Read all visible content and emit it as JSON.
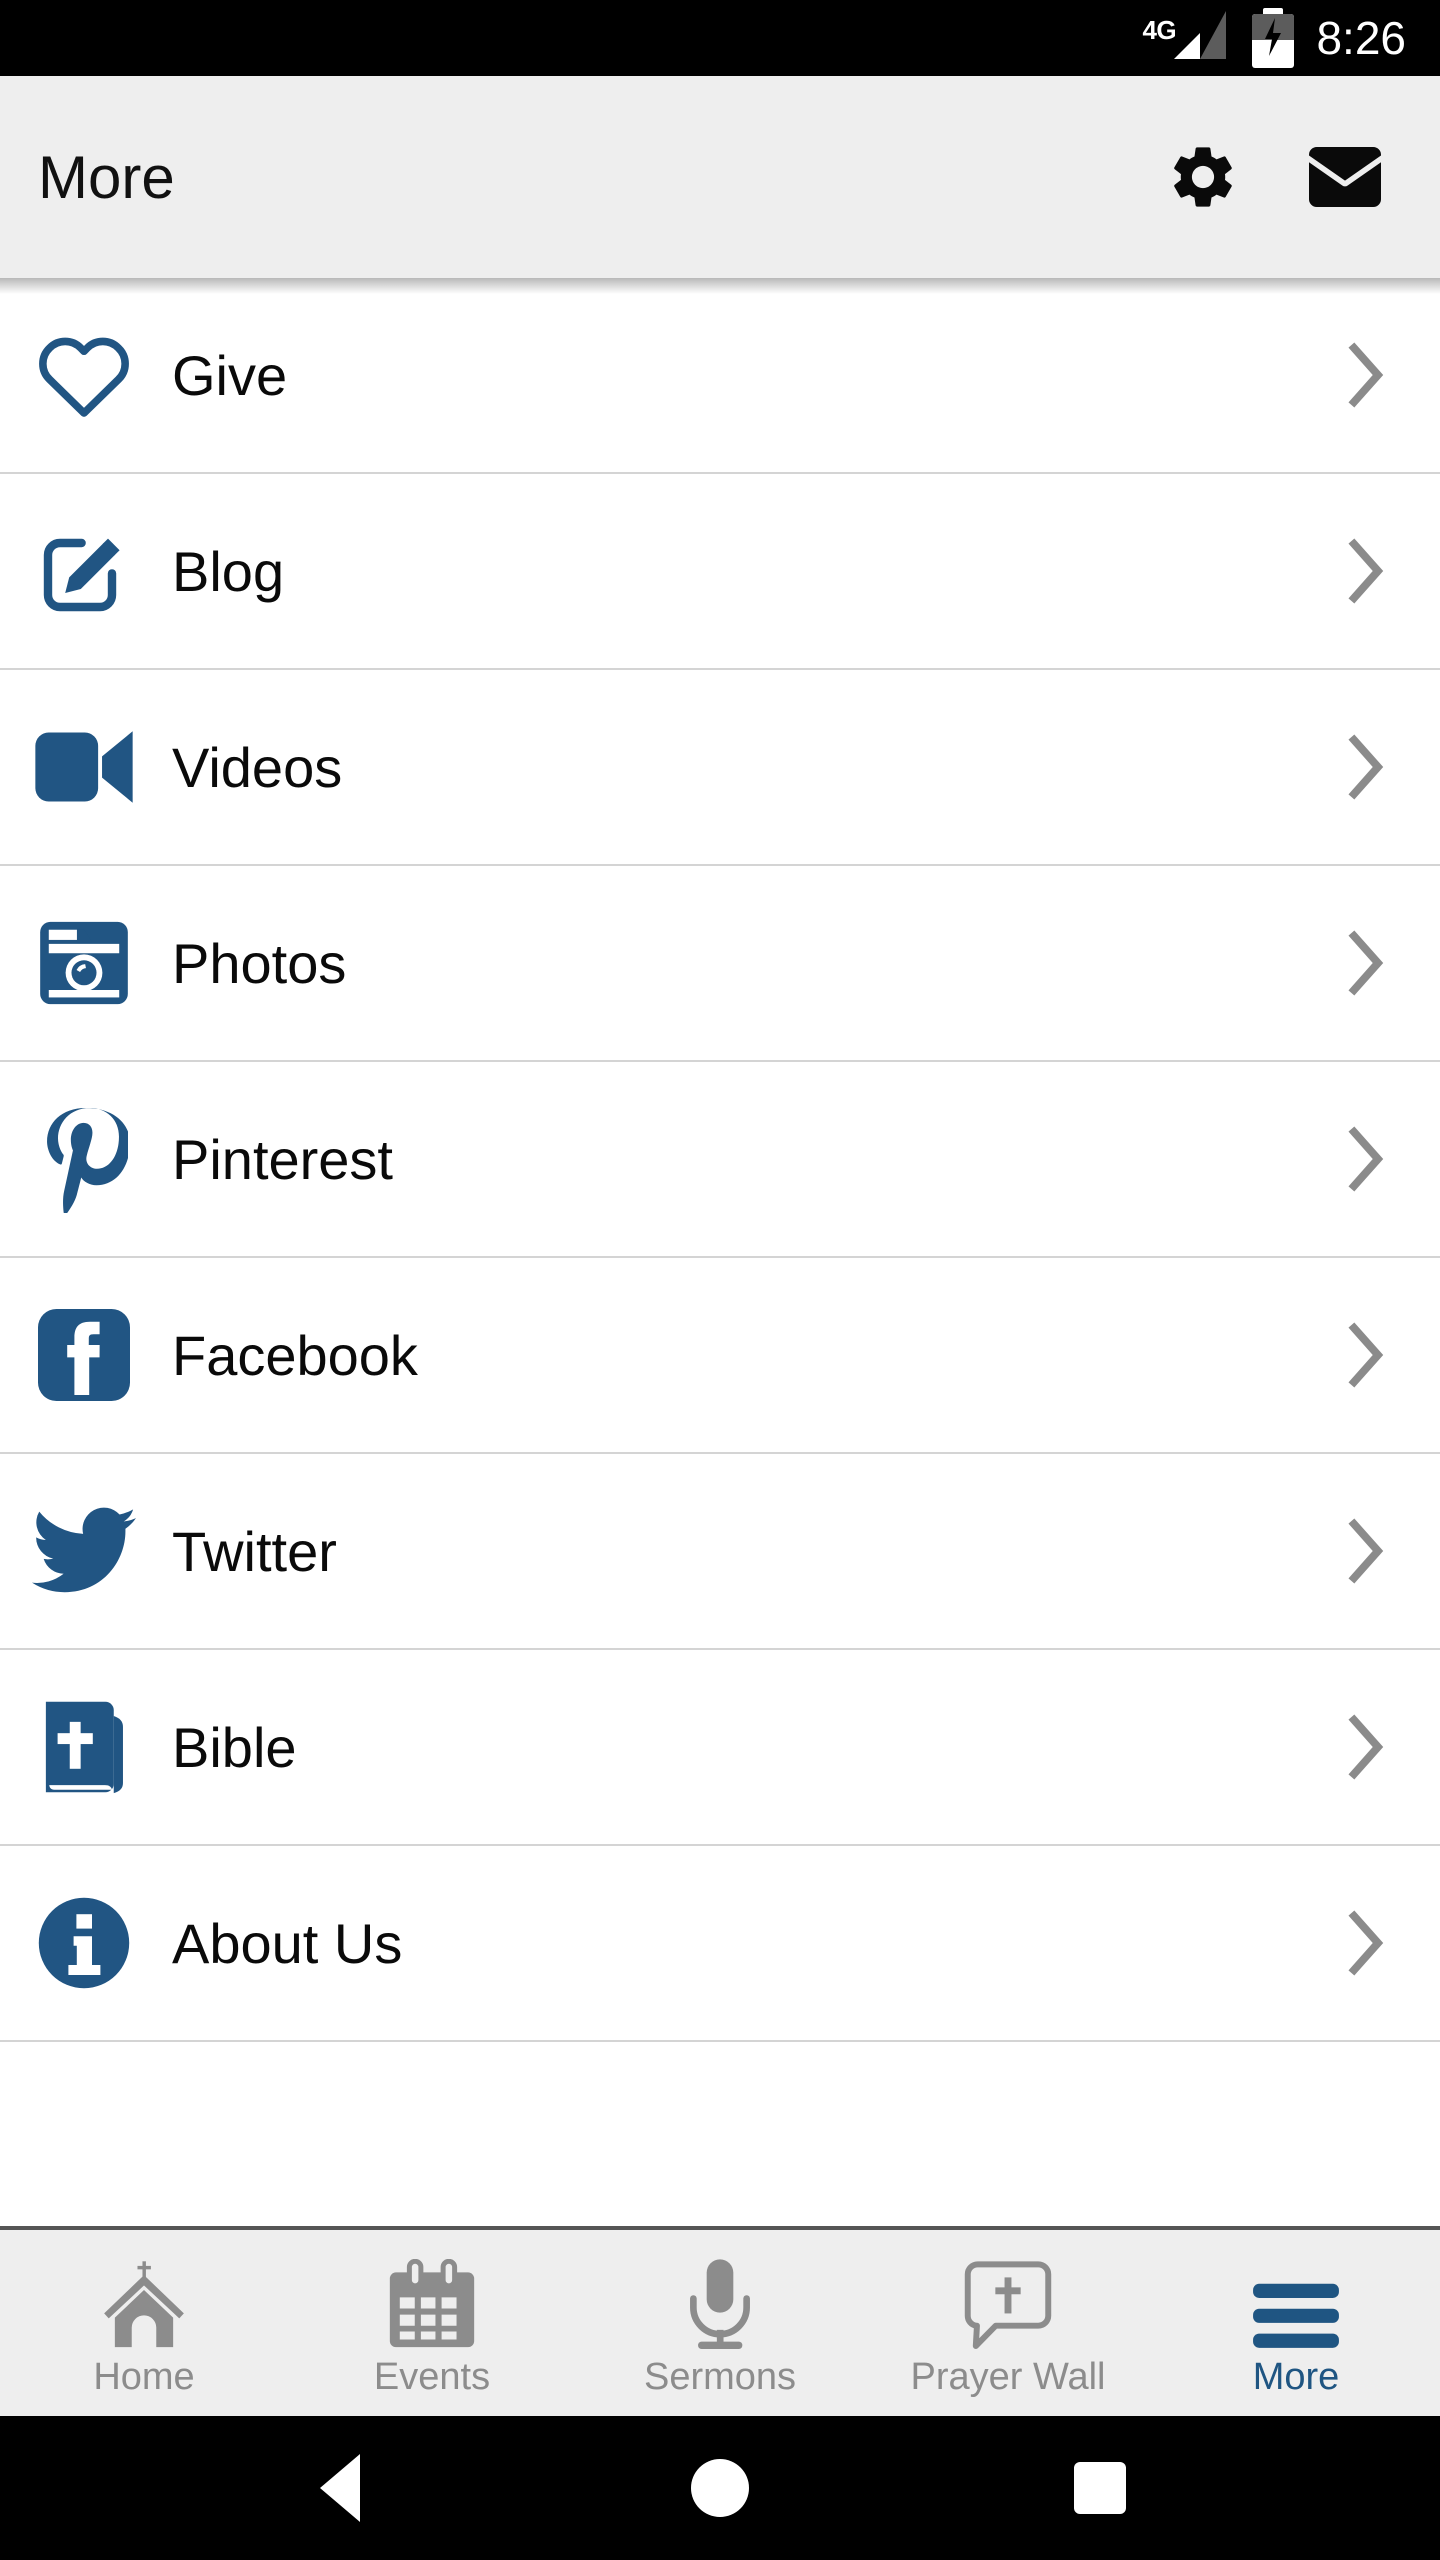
{
  "statusbar": {
    "network_label": "4G",
    "time": "8:26",
    "battery_icon": "battery-charging-icon",
    "signal_icon": "signal-bars-icon"
  },
  "header": {
    "title": "More",
    "settings_icon": "gear-icon",
    "mail_icon": "envelope-icon",
    "background": "#eeeeee"
  },
  "theme": {
    "accent_blue": "#1f5582",
    "icon_blue": "#215583",
    "chevron_gray": "#8b8b8b",
    "tab_inactive": "#8c8c8c",
    "divider": "#d4d4d4"
  },
  "list": {
    "chevron_icon": "chevron-right-icon",
    "items": [
      {
        "label": "Give",
        "icon": "heart-outline-icon"
      },
      {
        "label": "Blog",
        "icon": "pencil-square-icon"
      },
      {
        "label": "Videos",
        "icon": "video-camera-icon"
      },
      {
        "label": "Photos",
        "icon": "camera-icon"
      },
      {
        "label": "Pinterest",
        "icon": "pinterest-icon"
      },
      {
        "label": "Facebook",
        "icon": "facebook-icon"
      },
      {
        "label": "Twitter",
        "icon": "twitter-bird-icon"
      },
      {
        "label": "Bible",
        "icon": "bible-book-icon"
      },
      {
        "label": "About Us",
        "icon": "info-circle-icon"
      }
    ]
  },
  "tabbar": {
    "tabs": [
      {
        "label": "Home",
        "icon": "church-icon",
        "active": false
      },
      {
        "label": "Events",
        "icon": "calendar-icon",
        "active": false
      },
      {
        "label": "Sermons",
        "icon": "microphone-icon",
        "active": false
      },
      {
        "label": "Prayer Wall",
        "icon": "speech-cross-icon",
        "active": false
      },
      {
        "label": "More",
        "icon": "hamburger-menu-icon",
        "active": true
      }
    ]
  },
  "navbar": {
    "back_icon": "back-triangle-icon",
    "home_icon": "home-circle-icon",
    "recents_icon": "recents-square-icon"
  }
}
